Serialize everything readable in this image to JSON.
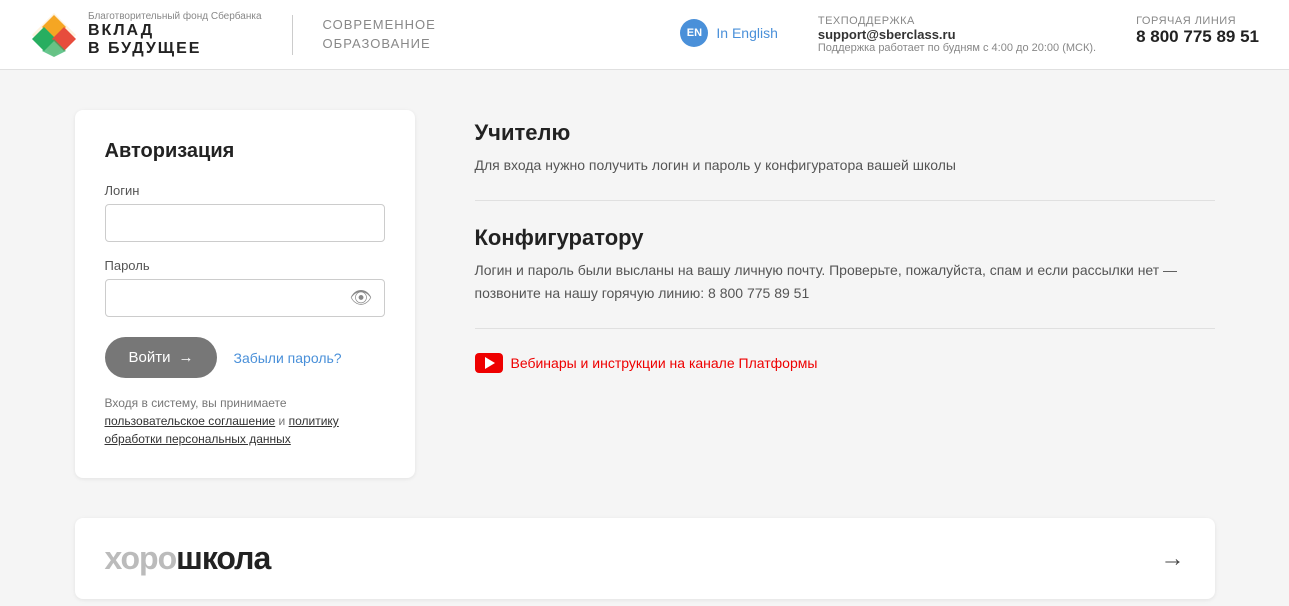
{
  "header": {
    "logo_text_top": "Благотворительный фонд Сбербанка",
    "logo_text_main_line1": "ВКЛАД",
    "logo_text_main_line2": "В БУДУЩЕЕ",
    "subtitle_line1": "СОВРЕМЕННОЕ",
    "subtitle_line2": "ОБРАЗОВАНИЕ",
    "lang_badge": "EN",
    "lang_label": "In English",
    "support_label": "ТЕХПОДДЕРЖКА",
    "support_email": "support@sberclass.ru",
    "support_note": "Поддержка работает по будням с 4:00 до 20:00 (МСК).",
    "hotline_label": "ГОРЯЧАЯ ЛИНИЯ",
    "hotline_number": "8 800 775 89 51"
  },
  "auth": {
    "title": "Авторизация",
    "login_label": "Логин",
    "login_placeholder": "",
    "password_label": "Пароль",
    "password_placeholder": "",
    "submit_label": "Войти",
    "arrow": "→",
    "forgot_label": "Забыли пароль?",
    "terms_text": "Входя в систему, вы принимаете ",
    "terms_link1": "пользовательское соглашение",
    "terms_and": " и ",
    "terms_link2": "политику обработки персональных данных"
  },
  "info": {
    "teacher_title": "Учителю",
    "teacher_text": "Для входа нужно получить логин и пароль у конфигуратора вашей школы",
    "configurator_title": "Конфигуратору",
    "configurator_text": "Логин и пароль были высланы на вашу личную почту. Проверьте, пожалуйста, спам и если рассылки нет — позвоните на нашу горячую линию: 8 800 775 89 51",
    "youtube_label": "Вебинары и инструкции на канале Платформы"
  },
  "banner": {
    "text_gray": "хоро",
    "text_dark": "школа",
    "arrow": "→"
  }
}
